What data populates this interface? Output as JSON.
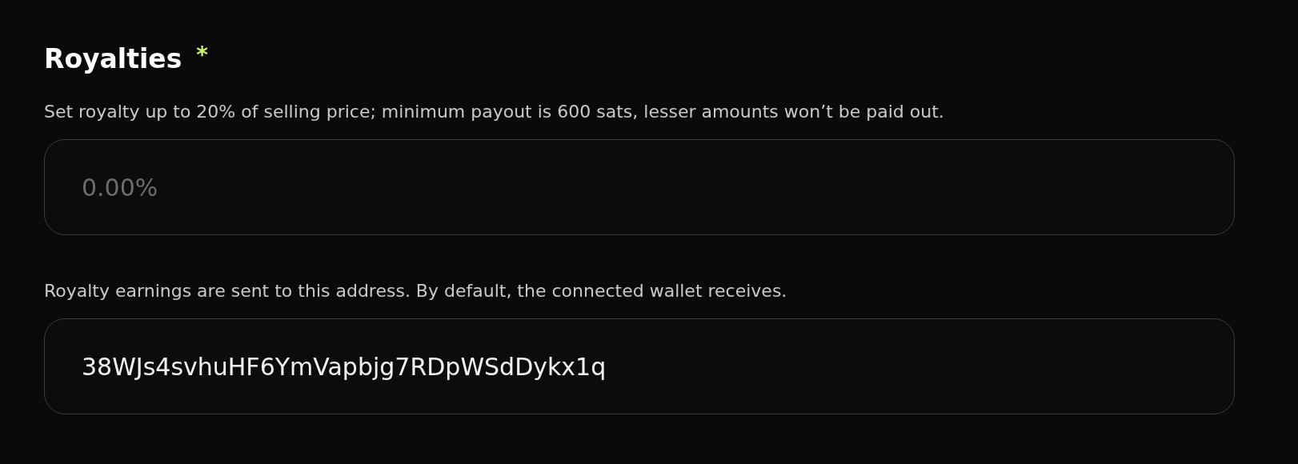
{
  "section": {
    "title": "Royalties",
    "required_mark": "*",
    "fields": [
      {
        "label": "Set royalty up to 20% of selling price; minimum payout is 600 sats, lesser amounts won’t be paid out.",
        "placeholder": "0.00%"
      },
      {
        "label": "Royalty earnings are sent to this address. By default, the connected wallet receives.",
        "value": "38WJs4svhuHF6YmVapbjg7RDpWSdDykx1q"
      }
    ]
  }
}
